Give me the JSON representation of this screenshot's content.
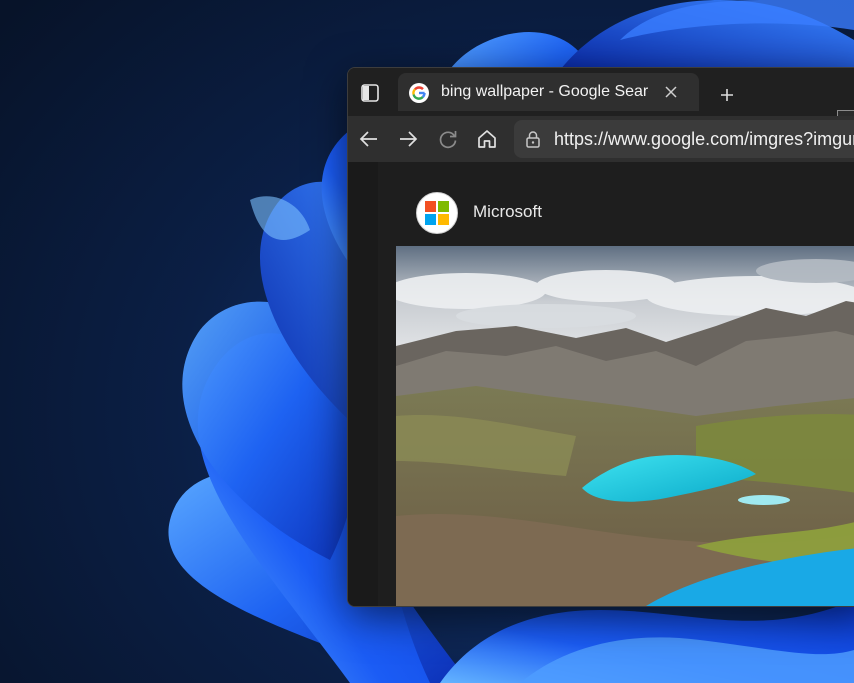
{
  "browser": {
    "tab": {
      "title": "bing wallpaper - Google Search"
    },
    "address_bar": {
      "url": "https://www.google.com/imgres?imgurl=https://images.microsoft.com/bing-wallpaper"
    },
    "icons": {
      "sidebar_toggle": "sidebar-toggle-icon",
      "favicon": "google-favicon",
      "close": "close-icon",
      "new_tab": "plus-icon",
      "back": "back-arrow-icon",
      "forward": "forward-arrow-icon",
      "refresh": "refresh-icon",
      "home": "home-icon",
      "lock": "lock-icon"
    }
  },
  "result": {
    "source_name": "Microsoft",
    "image_subject": "mountain-lake-landscape"
  },
  "colors": {
    "wallpaper_base": "#0a1a33",
    "bloom_blue": "#1f5ff0",
    "browser_dark": "#202020",
    "tab_active": "#2f2f2f",
    "lake_turquoise": "#27d3e8",
    "ms_red": "#f25022",
    "ms_green": "#7fba00",
    "ms_blue": "#00a4ef",
    "ms_yellow": "#ffb900"
  }
}
